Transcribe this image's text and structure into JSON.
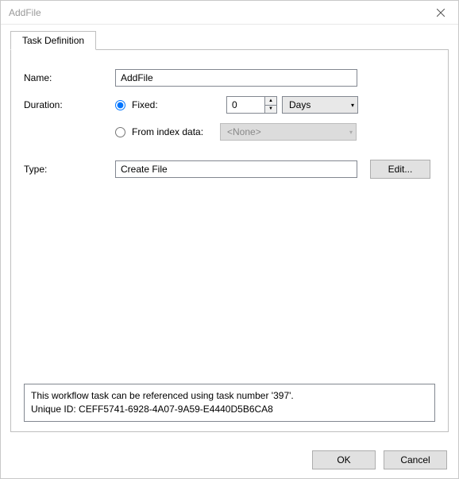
{
  "window": {
    "title": "AddFile"
  },
  "tab": {
    "label": "Task Definition"
  },
  "form": {
    "name_label": "Name:",
    "name_value": "AddFile",
    "duration_label": "Duration:",
    "fixed_label": "Fixed:",
    "fixed_value": "0",
    "units_selected": "Days",
    "from_index_label": "From index data:",
    "index_selected": "<None>",
    "type_label": "Type:",
    "type_value": "Create File",
    "edit_label": "Edit..."
  },
  "info": {
    "line1": "This workflow task can be referenced using task number '397'.",
    "line2": "Unique ID: CEFF5741-6928-4A07-9A59-E4440D5B6CA8"
  },
  "footer": {
    "ok": "OK",
    "cancel": "Cancel"
  }
}
